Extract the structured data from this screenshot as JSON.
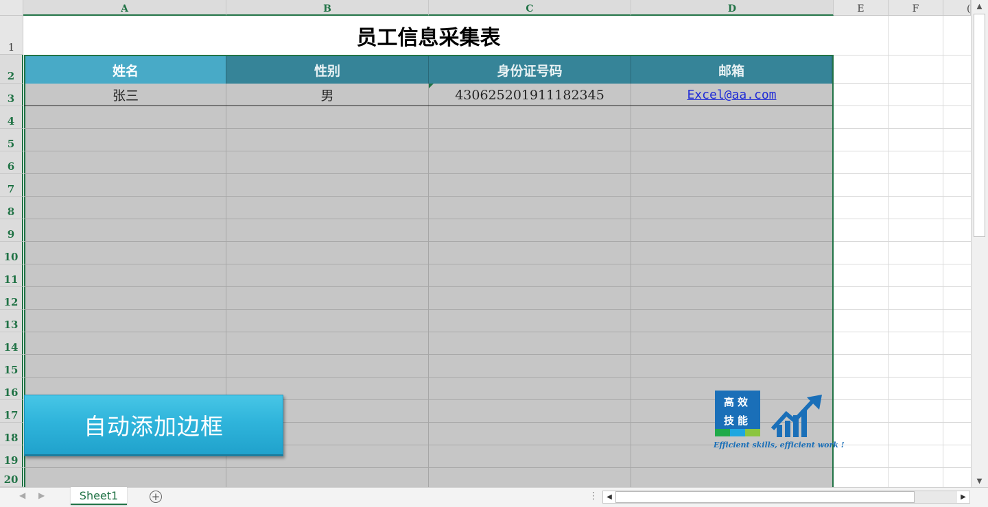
{
  "columns": [
    "A",
    "B",
    "C",
    "D",
    "E",
    "F",
    "("
  ],
  "rows": [
    "1",
    "2",
    "3",
    "4",
    "5",
    "6",
    "7",
    "8",
    "9",
    "10",
    "11",
    "12",
    "13",
    "14",
    "15",
    "16",
    "17",
    "18",
    "19",
    "20"
  ],
  "title": "员工信息采集表",
  "table": {
    "headers": [
      "姓名",
      "性别",
      "身份证号码",
      "邮箱"
    ],
    "row": [
      "张三",
      "男",
      "430625201911182345",
      "Excel@aa.com"
    ]
  },
  "button": {
    "label": "自动添加边框"
  },
  "logo": {
    "line1": "高效",
    "line2": "技能",
    "caption": "Efficient skills, efficient work !"
  },
  "sheet_tab": "Sheet1",
  "add_sheet": "+",
  "colors": {
    "header_dark": "#368498",
    "header_active": "#48aac7",
    "data_fill": "#c6c6c6",
    "accent_green": "#217346",
    "button": "#2fb4db"
  },
  "icons": [
    "growth-chart-icon",
    "plus-circle-icon",
    "scroll-up-icon",
    "scroll-down-icon",
    "scroll-left-icon",
    "scroll-right-icon"
  ]
}
